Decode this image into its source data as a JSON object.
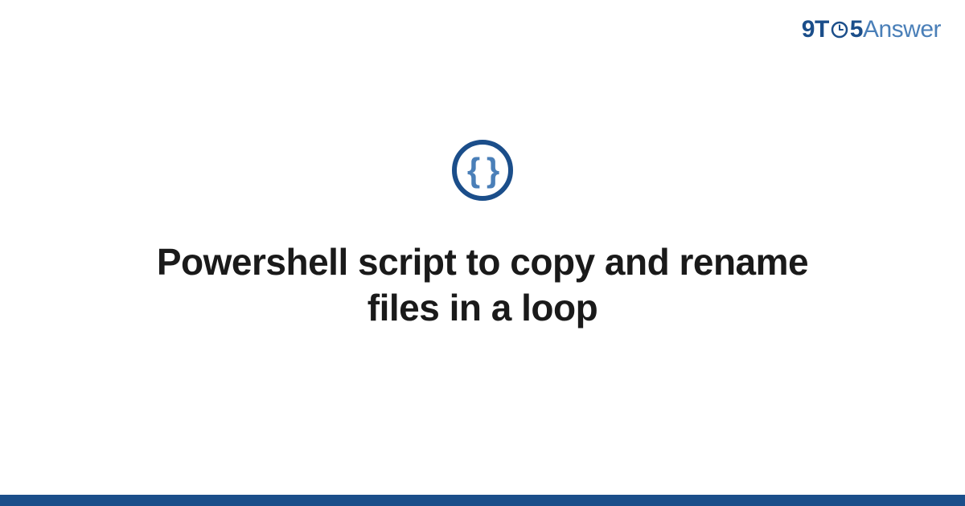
{
  "logo": {
    "part1": "9",
    "part2": "T",
    "part3": "5",
    "part4": "Answer"
  },
  "icon": {
    "name": "braces-icon",
    "glyph": "{ }"
  },
  "title": "Powershell script to copy and rename files in a loop",
  "colors": {
    "primary": "#1b4e8a",
    "secondary": "#4a7fb8",
    "text": "#1a1a1a"
  }
}
